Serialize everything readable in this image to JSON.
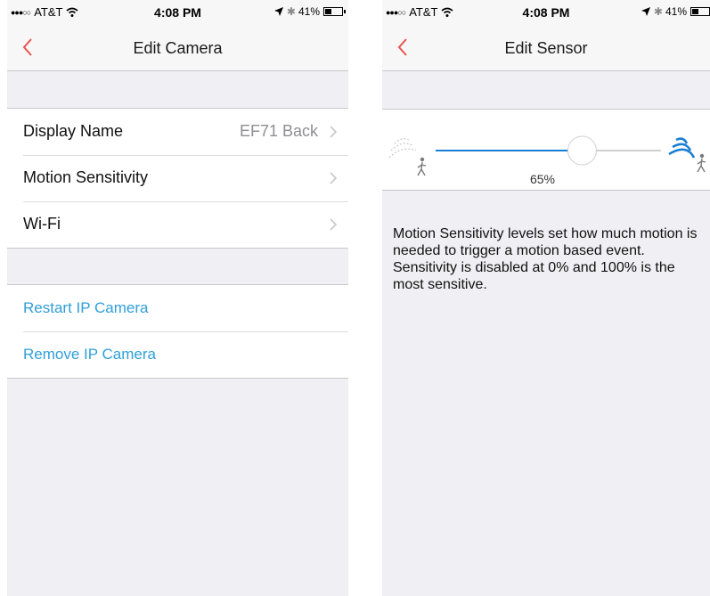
{
  "status_bar": {
    "carrier": "AT&T",
    "signal_dots": "●●●○○",
    "time": "4:08 PM",
    "battery": "41%",
    "battery_level": 0.41
  },
  "left_screen": {
    "title": "Edit Camera",
    "settings": [
      {
        "label": "Display Name",
        "value": "EF71 Back"
      },
      {
        "label": "Motion Sensitivity",
        "value": ""
      },
      {
        "label": "Wi-Fi",
        "value": ""
      }
    ],
    "actions": [
      {
        "label": "Restart IP Camera"
      },
      {
        "label": "Remove IP Camera"
      }
    ]
  },
  "right_screen": {
    "title": "Edit Sensor",
    "slider": {
      "value_label": "65%",
      "value": 0.65
    },
    "description": "Motion Sensitivity levels set how much motion is needed to trigger a motion based event. Sensitivity is disabled at 0% and 100% is the most sensitive."
  },
  "colors": {
    "accent_red": "#e8544e",
    "link_blue": "#2f9fd8",
    "slider_blue": "#1a7fd4",
    "background": "#efeff4"
  },
  "icons": [
    "back-chevron-icon",
    "chevron-right-icon",
    "wifi-icon",
    "location-arrow-icon",
    "bluetooth-icon",
    "battery-icon",
    "low-sensitivity-icon",
    "high-sensitivity-icon"
  ]
}
